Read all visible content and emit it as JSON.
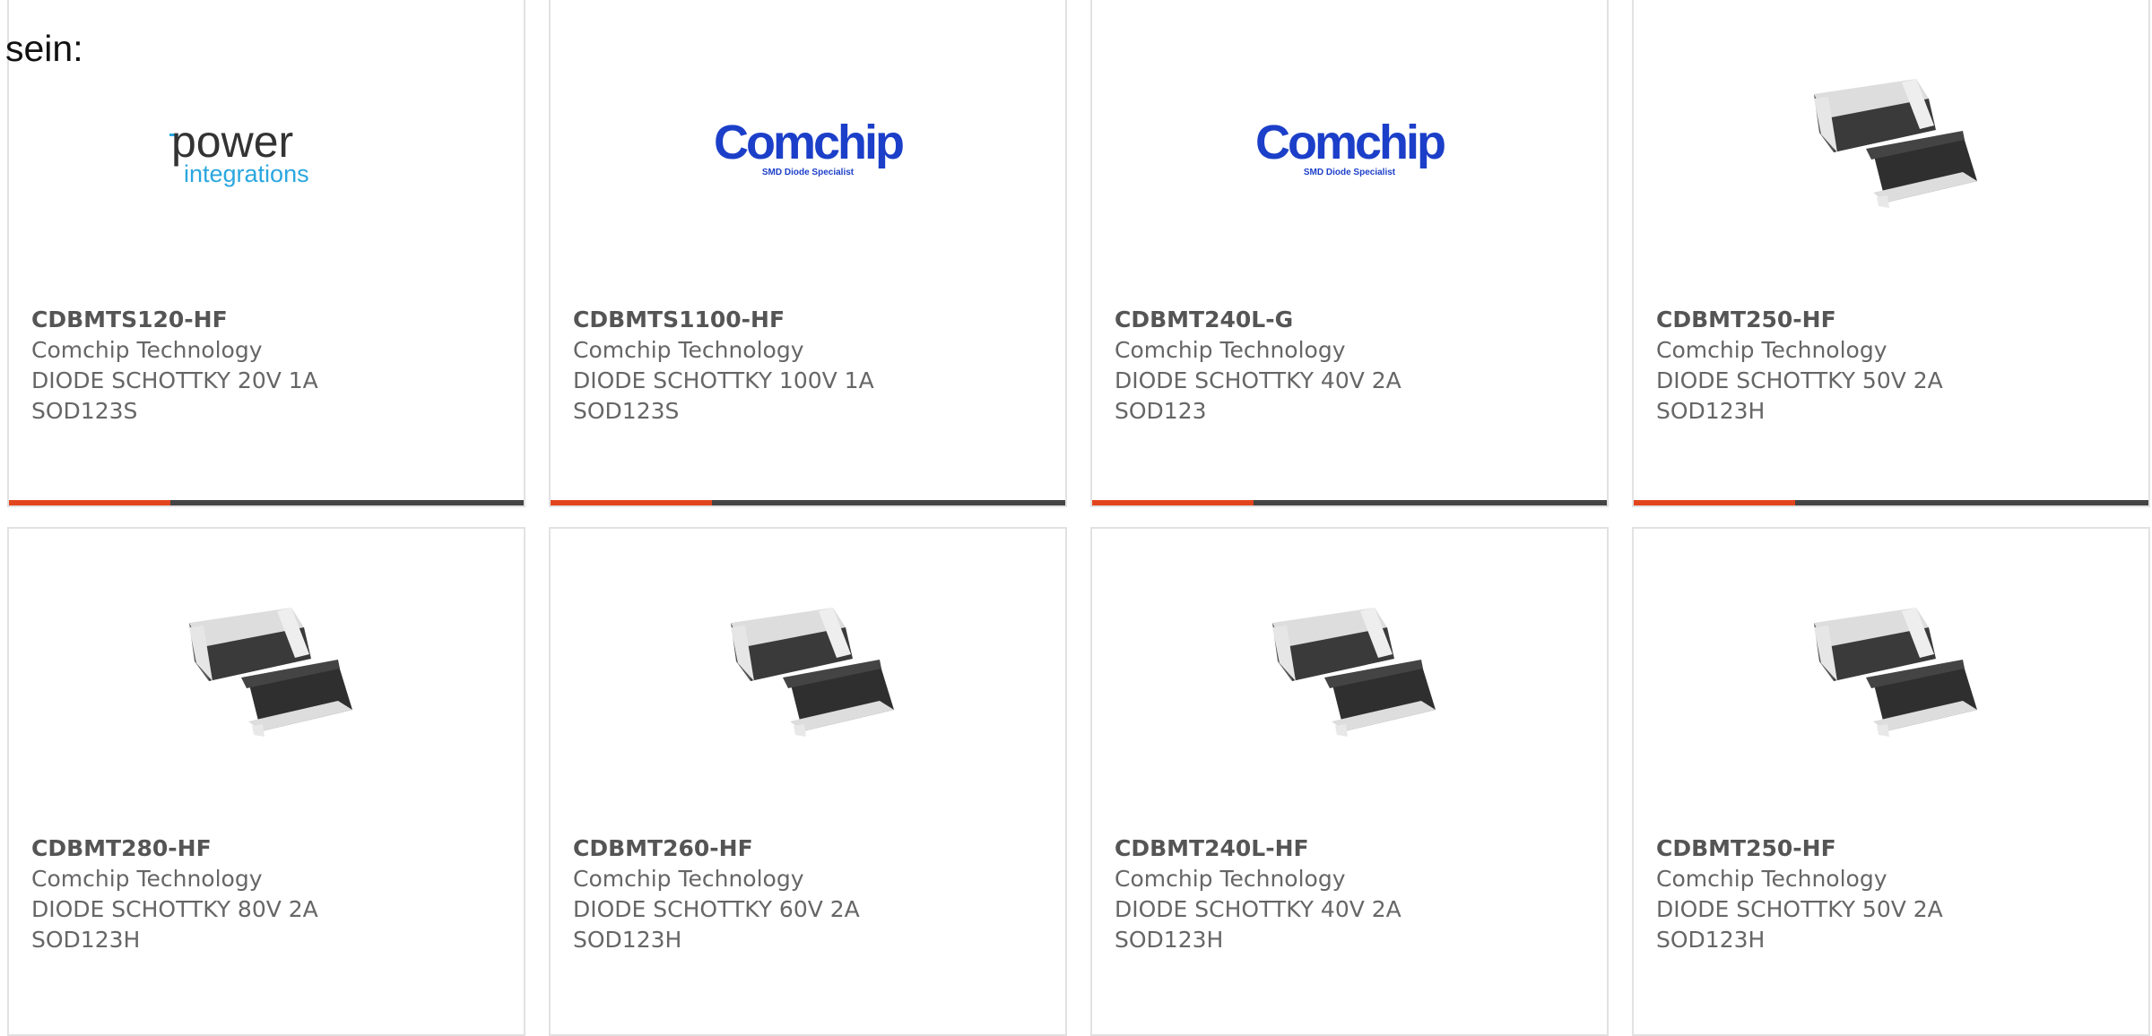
{
  "intro_text": "sein:",
  "colors": {
    "accent": "#e2451e",
    "bar": "#444444",
    "power_blue": "#2aa7df",
    "comchip_blue": "#1c3fc9"
  },
  "products": [
    {
      "part_number": "CDBMTS120-HF",
      "manufacturer": "Comchip Technology",
      "description": "DIODE SCHOTTKY 20V 1A",
      "package": "SOD123S",
      "image": "power-integrations-logo",
      "logo_top": "power",
      "logo_bottom": "integrations"
    },
    {
      "part_number": "CDBMTS1100-HF",
      "manufacturer": "Comchip Technology",
      "description": "DIODE SCHOTTKY 100V 1A",
      "package": "SOD123S",
      "image": "comchip-logo",
      "logo_top": "Comchip",
      "logo_bottom": "SMD Diode Specialist"
    },
    {
      "part_number": "CDBMT240L-G",
      "manufacturer": "Comchip Technology",
      "description": "DIODE SCHOTTKY 40V 2A",
      "package": "SOD123",
      "image": "comchip-logo",
      "logo_top": "Comchip",
      "logo_bottom": "SMD Diode Specialist"
    },
    {
      "part_number": "CDBMT250-HF",
      "manufacturer": "Comchip Technology",
      "description": "DIODE SCHOTTKY 50V 2A",
      "package": "SOD123H",
      "image": "smd-diode-photo"
    },
    {
      "part_number": "CDBMT280-HF",
      "manufacturer": "Comchip Technology",
      "description": "DIODE SCHOTTKY 80V 2A",
      "package": "SOD123H",
      "image": "smd-diode-photo"
    },
    {
      "part_number": "CDBMT260-HF",
      "manufacturer": "Comchip Technology",
      "description": "DIODE SCHOTTKY 60V 2A",
      "package": "SOD123H",
      "image": "smd-diode-photo"
    },
    {
      "part_number": "CDBMT240L-HF",
      "manufacturer": "Comchip Technology",
      "description": "DIODE SCHOTTKY 40V 2A",
      "package": "SOD123H",
      "image": "smd-diode-photo"
    },
    {
      "part_number": "CDBMT250-HF",
      "manufacturer": "Comchip Technology",
      "description": "DIODE SCHOTTKY 50V 2A",
      "package": "SOD123H",
      "image": "smd-diode-photo"
    }
  ]
}
